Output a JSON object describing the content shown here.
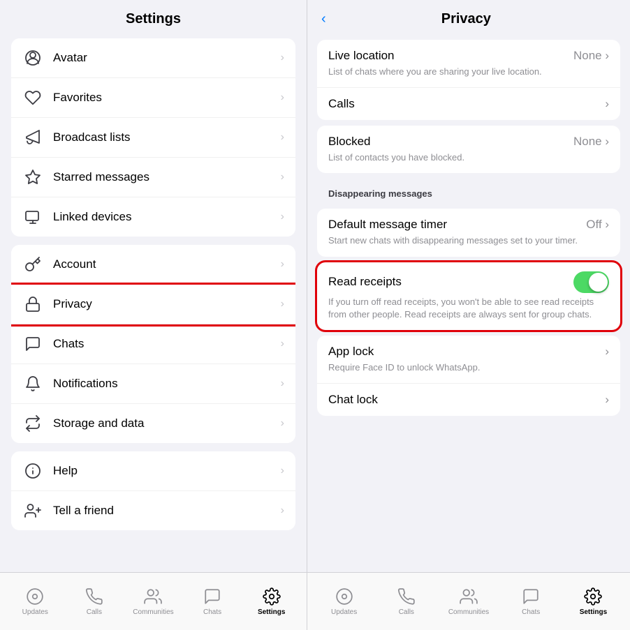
{
  "left": {
    "title": "Settings",
    "sections": [
      {
        "id": "section1",
        "items": [
          {
            "id": "avatar",
            "label": "Avatar",
            "icon": "avatar"
          },
          {
            "id": "favorites",
            "label": "Favorites",
            "icon": "heart"
          },
          {
            "id": "broadcast",
            "label": "Broadcast lists",
            "icon": "megaphone"
          },
          {
            "id": "starred",
            "label": "Starred messages",
            "icon": "star"
          },
          {
            "id": "linked",
            "label": "Linked devices",
            "icon": "monitor"
          }
        ]
      },
      {
        "id": "section2",
        "items": [
          {
            "id": "account",
            "label": "Account",
            "icon": "key"
          },
          {
            "id": "privacy",
            "label": "Privacy",
            "icon": "lock",
            "highlighted": true
          },
          {
            "id": "chats",
            "label": "Chats",
            "icon": "chat"
          },
          {
            "id": "notifications",
            "label": "Notifications",
            "icon": "bell"
          },
          {
            "id": "storage",
            "label": "Storage and data",
            "icon": "arrows"
          }
        ]
      },
      {
        "id": "section3",
        "items": [
          {
            "id": "help",
            "label": "Help",
            "icon": "info"
          },
          {
            "id": "friend",
            "label": "Tell a friend",
            "icon": "person-plus"
          }
        ]
      }
    ],
    "nav": [
      {
        "id": "updates",
        "label": "Updates",
        "icon": "circle-dot",
        "active": false
      },
      {
        "id": "calls",
        "label": "Calls",
        "icon": "phone",
        "active": false
      },
      {
        "id": "communities",
        "label": "Communities",
        "icon": "people",
        "active": false
      },
      {
        "id": "chats",
        "label": "Chats",
        "icon": "bubble",
        "active": false
      },
      {
        "id": "settings",
        "label": "Settings",
        "icon": "gear",
        "active": true
      }
    ]
  },
  "right": {
    "title": "Privacy",
    "items": [
      {
        "section": "top",
        "rows": [
          {
            "id": "live-location",
            "label": "Live location",
            "value": "None",
            "sub": "List of chats where you are sharing your live location."
          },
          {
            "id": "calls",
            "label": "Calls",
            "value": "",
            "sub": ""
          }
        ]
      },
      {
        "section": "blocked",
        "rows": [
          {
            "id": "blocked",
            "label": "Blocked",
            "value": "None",
            "sub": "List of contacts you have blocked."
          }
        ]
      },
      {
        "section": "disappearing",
        "header": "Disappearing messages",
        "rows": [
          {
            "id": "message-timer",
            "label": "Default message timer",
            "value": "Off",
            "sub": "Start new chats with disappearing messages set to your timer."
          }
        ]
      },
      {
        "section": "read-receipts",
        "rows": [
          {
            "id": "read-receipts",
            "label": "Read receipts",
            "toggle": true,
            "toggleOn": true,
            "sub": "If you turn off read receipts, you won't be able to see read receipts from other people. Read receipts are always sent for group chats."
          }
        ]
      },
      {
        "section": "applock",
        "rows": [
          {
            "id": "app-lock",
            "label": "App lock",
            "value": "",
            "sub": "Require Face ID to unlock WhatsApp."
          },
          {
            "id": "chat-lock",
            "label": "Chat lock",
            "value": ""
          }
        ]
      }
    ],
    "nav": [
      {
        "id": "updates",
        "label": "Updates",
        "icon": "circle-dot",
        "active": false
      },
      {
        "id": "calls",
        "label": "Calls",
        "icon": "phone",
        "active": false
      },
      {
        "id": "communities",
        "label": "Communities",
        "icon": "people",
        "active": false
      },
      {
        "id": "chats",
        "label": "Chats",
        "icon": "bubble",
        "active": false
      },
      {
        "id": "settings",
        "label": "Settings",
        "icon": "gear",
        "active": true
      }
    ]
  }
}
